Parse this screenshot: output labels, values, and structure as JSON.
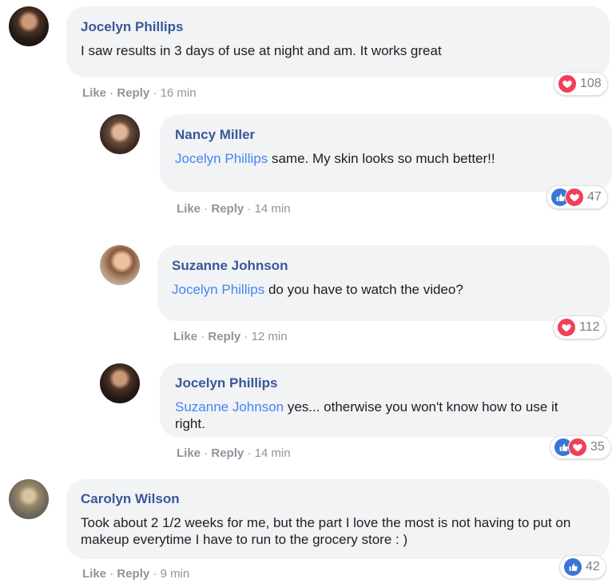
{
  "comments": [
    {
      "author": "Jocelyn Phillips",
      "text": "I saw results in 3 days of use at night and am. It works great",
      "like": "Like",
      "reply": "Reply",
      "time": "16 min",
      "reactions": {
        "icons": [
          "love-icon"
        ],
        "count": "108"
      }
    },
    {
      "author": "Nancy Miller",
      "mention": "Jocelyn Phillips",
      "text": " same. My skin looks so much better!!",
      "like": "Like",
      "reply": "Reply",
      "time": "14 min",
      "reactions": {
        "icons": [
          "like-icon",
          "love-icon"
        ],
        "count": "47"
      }
    },
    {
      "author": "Suzanne Johnson",
      "mention": "Jocelyn Phillips",
      "text": " do you have to watch the video?",
      "like": "Like",
      "reply": "Reply",
      "time": "12 min",
      "reactions": {
        "icons": [
          "love-icon"
        ],
        "count": "112"
      }
    },
    {
      "author": "Jocelyn Phillips",
      "mention": "Suzanne Johnson",
      "text": " yes... otherwise you won't know how to use it right.",
      "like": "Like",
      "reply": "Reply",
      "time": "14 min",
      "reactions": {
        "icons": [
          "like-icon",
          "love-icon"
        ],
        "count": "35"
      }
    },
    {
      "author": "Carolyn Wilson",
      "text": "Took about 2 1/2 weeks for me, but the part I love the most is not having to put on makeup everytime I have to run to the grocery store : )",
      "like": "Like",
      "reply": "Reply",
      "time": "9 min",
      "reactions": {
        "icons": [
          "like-icon"
        ],
        "count": "42"
      }
    }
  ],
  "separator": " · ",
  "colors": {
    "author": "#385898",
    "mention": "#4385f5",
    "bubble": "#f2f3f5",
    "love": "#f33e58",
    "like": "#3b76d6",
    "meta": "#90949c"
  }
}
